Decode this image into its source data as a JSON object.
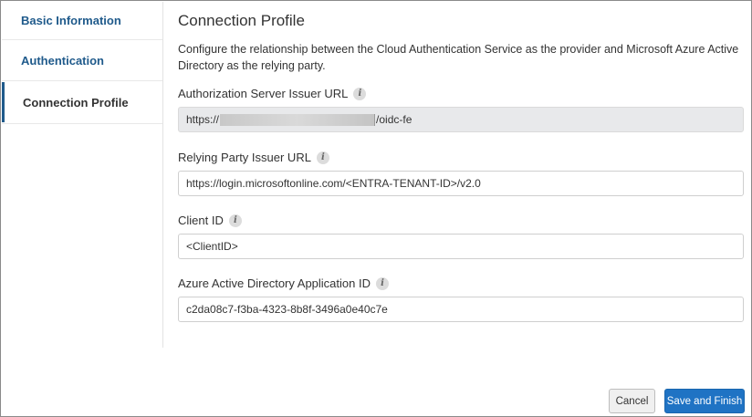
{
  "sidebar": {
    "items": [
      {
        "label": "Basic Information"
      },
      {
        "label": "Authentication"
      },
      {
        "label": "Connection Profile"
      }
    ]
  },
  "main": {
    "title": "Connection Profile",
    "description": "Configure the relationship between the Cloud Authentication Service as the provider and Microsoft Azure Active Directory as the relying party.",
    "fields": [
      {
        "label": "Authorization Server Issuer URL",
        "value_prefix": "https://",
        "value_suffix": "/oidc-fe"
      },
      {
        "label": "Relying Party Issuer URL",
        "value": "https://login.microsoftonline.com/<ENTRA-TENANT-ID>/v2.0"
      },
      {
        "label": "Client ID",
        "value": "<ClientID>"
      },
      {
        "label": "Azure Active Directory Application ID",
        "value": "c2da08c7-f3ba-4323-8b8f-3496a0e40c7e"
      }
    ],
    "info_glyph": "i"
  },
  "buttons": {
    "cancel": "Cancel",
    "save": "Save and Finish"
  },
  "colors": {
    "accent": "#1f5a8b",
    "primary_button": "#1f73c4",
    "readonly_field": "#e8e9eb"
  }
}
